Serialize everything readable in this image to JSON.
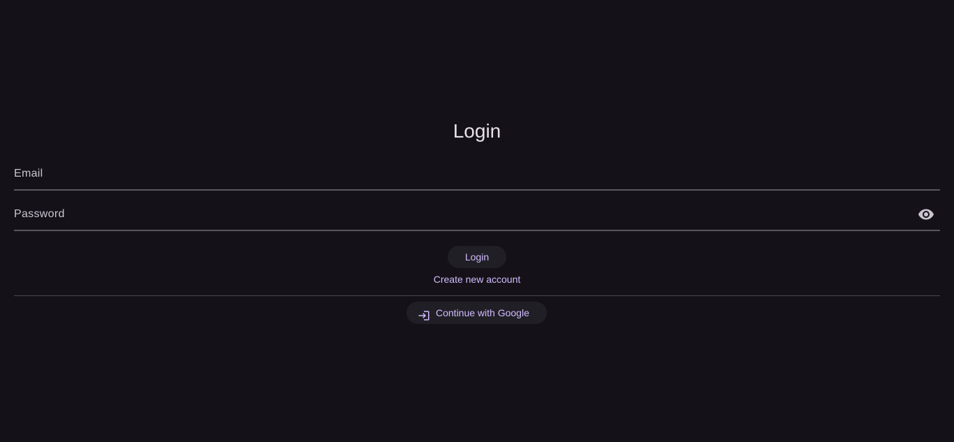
{
  "page": {
    "title": "Login"
  },
  "form": {
    "email_label": "Email",
    "password_label": "Password",
    "login_button": "Login",
    "create_account_link": "Create new account",
    "google_button": "Continue with Google"
  },
  "icons": {
    "password_toggle": "eye-icon",
    "google_button": "login-icon"
  },
  "colors": {
    "background": "#141218",
    "accent": "#d0bcff",
    "button_surface": "#211f26"
  }
}
